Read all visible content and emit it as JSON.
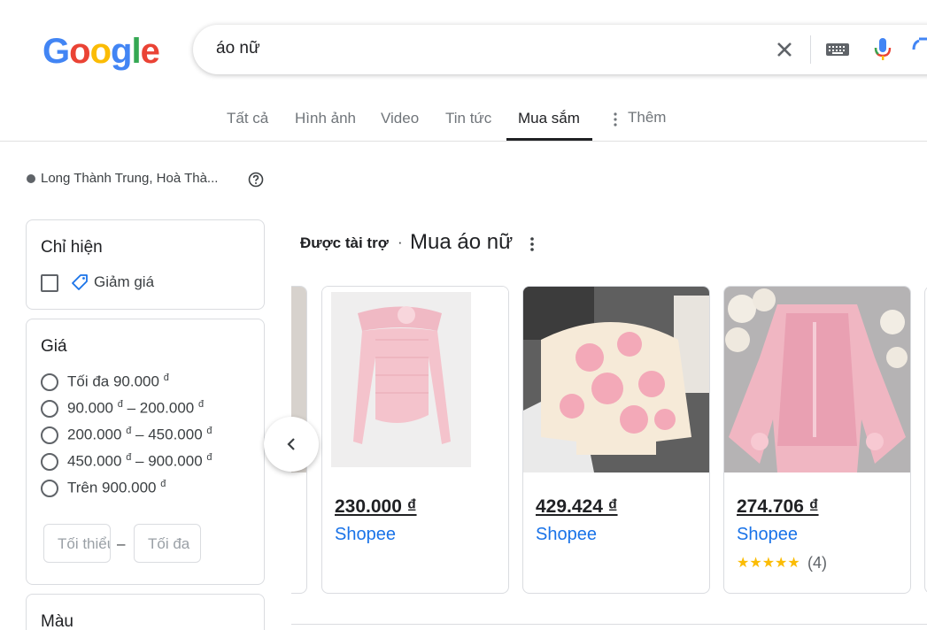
{
  "search": {
    "query": "áo nữ"
  },
  "tabs": [
    {
      "label": "Tất cả"
    },
    {
      "label": "Hình ảnh"
    },
    {
      "label": "Video"
    },
    {
      "label": "Tin tức"
    },
    {
      "label": "Mua sắm"
    },
    {
      "label": "Thêm"
    }
  ],
  "location": {
    "text": "Long Thành Trung, Hoà Thà..."
  },
  "filters": {
    "show_only": {
      "title": "Chỉ hiện",
      "option": "Giảm giá"
    },
    "price": {
      "title": "Giá",
      "options": [
        {
          "label": "Tối đa 90.000",
          "currency": "đ"
        },
        {
          "label_a": "90.000",
          "label_b": "– 200.000",
          "currency": "đ"
        },
        {
          "label_a": "200.000",
          "label_b": "– 450.000",
          "currency": "đ"
        },
        {
          "label_a": "450.000",
          "label_b": "– 900.000",
          "currency": "đ"
        },
        {
          "label": "Trên 900.000",
          "currency": "đ"
        }
      ],
      "min_placeholder": "Tối thiểu",
      "max_placeholder": "Tối đa",
      "dash": "–"
    },
    "color": {
      "title": "Màu"
    }
  },
  "sponsored": {
    "label": "Được tài trợ",
    "separator": "·",
    "title": "Mua áo nữ"
  },
  "products": [
    {
      "price": "230.000 ₫",
      "store": "Shopee"
    },
    {
      "price": "429.424 ₫",
      "store": "Shopee"
    },
    {
      "price": "274.706 ₫",
      "store": "Shopee",
      "stars": "★★★★★",
      "rating_count": "(4)"
    }
  ],
  "colors": {
    "link_blue": "#1a73e8",
    "star_yellow": "#fbbc04"
  }
}
